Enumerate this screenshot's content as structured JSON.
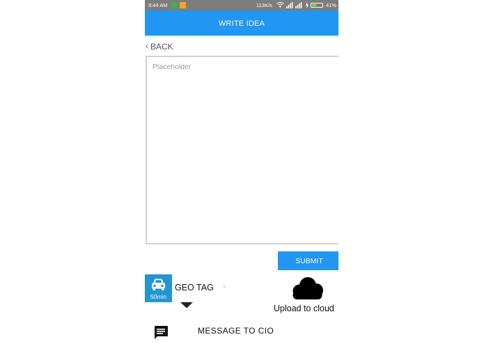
{
  "status_bar": {
    "time": "9:44 AM",
    "network_speed": "113K/s",
    "battery_percent": "41%",
    "battery_level": 0.41,
    "icons": [
      "app-green-icon",
      "app-orange-icon",
      "wifi-icon",
      "signal-icon",
      "signal-icon",
      "charging-icon",
      "battery-icon"
    ]
  },
  "header": {
    "title": "WRITE IDEA"
  },
  "nav": {
    "back_label": "BACK"
  },
  "editor": {
    "placeholder": "Placeholder"
  },
  "actions": {
    "submit_label": "SUBMIT"
  },
  "geo_tag": {
    "duration": "50min",
    "label": "GEO TAG"
  },
  "cloud": {
    "label": "Upload to cloud"
  },
  "message": {
    "label": "MESSAGE  TO  CIO"
  },
  "colors": {
    "primary": "#2196f3",
    "status_bar": "#7d7d7d",
    "tile": "#2196d3"
  }
}
